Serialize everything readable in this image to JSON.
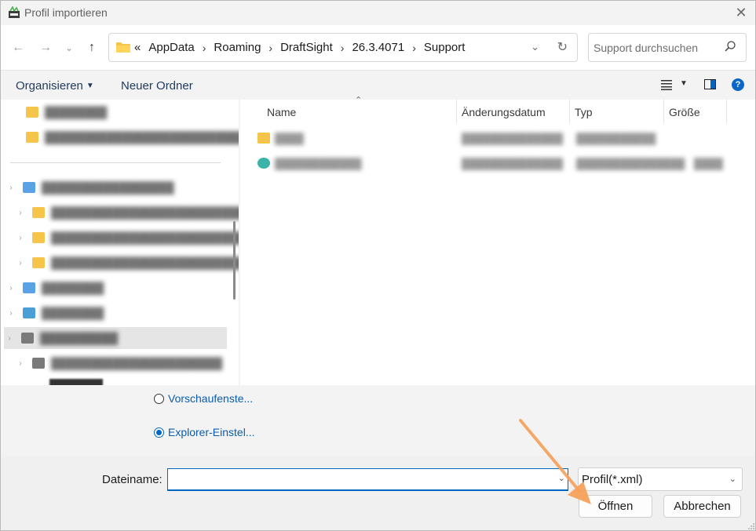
{
  "window": {
    "title": "Profil importieren"
  },
  "nav": {
    "breadcrumb_lead": "«",
    "breadcrumbs": [
      "AppData",
      "Roaming",
      "DraftSight",
      "26.3.4071",
      "Support"
    ],
    "search_placeholder": "Support durchsuchen"
  },
  "toolbar": {
    "organize_label": "Organisieren",
    "new_folder_label": "Neuer Ordner",
    "help_label": "?"
  },
  "file_list": {
    "columns": [
      "Name",
      "Änderungsdatum",
      "Typ",
      "Größe"
    ]
  },
  "options": {
    "preview_label": "Vorschaufenste...",
    "explorer_label": "Explorer-Einstel...",
    "selected": "explorer"
  },
  "bottom": {
    "filename_label": "Dateiname:",
    "filename_value": "",
    "filter_value": "Profil(*.xml)",
    "open_label": "Öffnen",
    "cancel_label": "Abbrechen"
  },
  "colors": {
    "accent": "#0067c0",
    "annotation_arrow": "#f5a05a"
  }
}
